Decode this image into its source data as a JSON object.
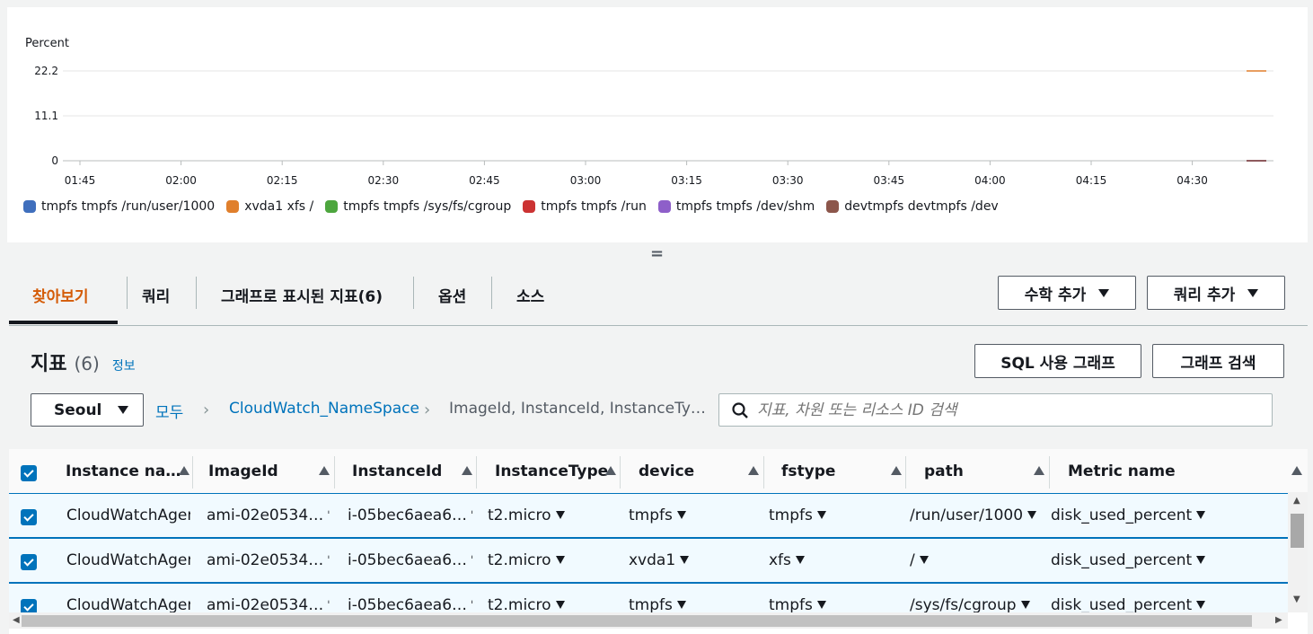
{
  "chart_data": {
    "type": "line",
    "ylabel": "Percent",
    "y_ticks": [
      "22.2",
      "11.1",
      "0"
    ],
    "ylim": [
      0,
      22.2
    ],
    "x_ticks": [
      "01:45",
      "02:00",
      "02:15",
      "02:30",
      "02:45",
      "03:00",
      "03:15",
      "03:30",
      "03:45",
      "04:00",
      "04:15",
      "04:30"
    ],
    "grid": true,
    "legend_position": "bottom-left",
    "series": [
      {
        "name": "tmpfs tmpfs /run/user/1000",
        "color": "#3f6fbd",
        "values": [
          0
        ]
      },
      {
        "name": "xvda1 xfs /",
        "color": "#e07f2c",
        "values": [
          22.2
        ]
      },
      {
        "name": "tmpfs tmpfs /sys/fs/cgroup",
        "color": "#4da63e",
        "values": [
          0
        ]
      },
      {
        "name": "tmpfs tmpfs /run",
        "color": "#cc3333",
        "values": [
          0
        ]
      },
      {
        "name": "tmpfs tmpfs /dev/shm",
        "color": "#8e5fc9",
        "values": [
          0
        ]
      },
      {
        "name": "devtmpfs devtmpfs /dev",
        "color": "#8c564b",
        "values": [
          0
        ]
      }
    ]
  },
  "drag_handle": "=",
  "tabs": [
    {
      "label": "찾아보기"
    },
    {
      "label": "쿼리"
    },
    {
      "label": "그래프로 표시된 지표(6)"
    },
    {
      "label": "옵션"
    },
    {
      "label": "소스"
    }
  ],
  "toolbar": {
    "add_math": "수학 추가",
    "add_query": "쿼리 추가",
    "sql_graph": "SQL 사용 그래프",
    "graph_search": "그래프 검색"
  },
  "metrics": {
    "title": "지표",
    "count": "(6)",
    "info": "정보"
  },
  "region": "Seoul",
  "breadcrumb": {
    "all": "모두",
    "namespace": "CloudWatch_NameSpace",
    "dimensions": "ImageId, InstanceId, InstanceTy…"
  },
  "search": {
    "placeholder": "지표, 차원 또는 리소스 ID 검색"
  },
  "table": {
    "columns": [
      "Instance na…",
      "ImageId",
      "InstanceId",
      "InstanceType",
      "device",
      "fstype",
      "path",
      "Metric name"
    ],
    "rows": [
      {
        "name": "CloudWatchAgen",
        "image": "ami-02e0534…",
        "instance": "i-05bec6aea6…",
        "type": "t2.micro",
        "device": "tmpfs",
        "fstype": "tmpfs",
        "path": "/run/user/1000",
        "metric": "disk_used_percent"
      },
      {
        "name": "CloudWatchAgen",
        "image": "ami-02e0534…",
        "instance": "i-05bec6aea6…",
        "type": "t2.micro",
        "device": "xvda1",
        "fstype": "xfs",
        "path": "/",
        "metric": "disk_used_percent"
      },
      {
        "name": "CloudWatchAgen",
        "image": "ami-02e0534…",
        "instance": "i-05bec6aea6…",
        "type": "t2.micro",
        "device": "tmpfs",
        "fstype": "tmpfs",
        "path": "/sys/fs/cgroup",
        "metric": "disk_used_percent"
      }
    ]
  },
  "colors": {
    "accent": "#0073bb",
    "active_tab": "#d45b07"
  }
}
